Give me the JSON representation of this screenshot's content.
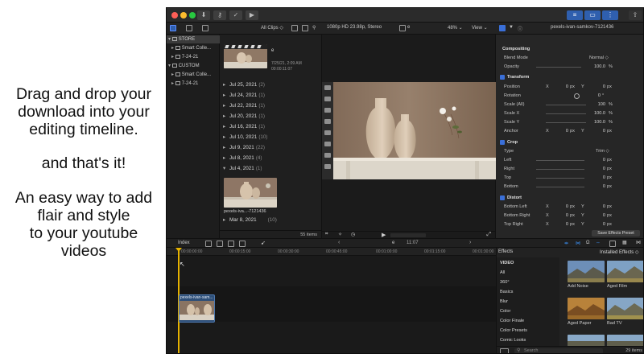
{
  "promo": {
    "line1": "Drag and drop your",
    "line2": "download into your",
    "line3": "editing timeline.",
    "line4": "and that's it!",
    "line5": "An easy way to add",
    "line6": "flair and style",
    "line7": "to your youtube",
    "line8": "videos"
  },
  "titlebar": {
    "right_buttons": [
      "≡",
      "▭",
      "⋮"
    ]
  },
  "toolbar": {
    "all_clips": "All Clips ◇",
    "format": "1080p HD 23.98p, Stereo",
    "clip_name": "e",
    "zoom": "48% ⌄",
    "view": "View ⌄",
    "inspector_title": "pexels-ivan-samkov-7121436"
  },
  "library": {
    "items": [
      {
        "label": "STORE",
        "selected": true
      },
      {
        "label": "Smart Colle...",
        "selected": false
      },
      {
        "label": "7-24-21",
        "selected": false
      },
      {
        "label": "CUSTOM",
        "selected": false
      },
      {
        "label": "Smart Colle...",
        "selected": false
      },
      {
        "label": "7-24-21",
        "selected": false
      }
    ]
  },
  "browser": {
    "top_clip": {
      "name": "e",
      "date": "7/25/21, 2:09 AM",
      "duration": "00:00:11:07"
    },
    "dates": [
      {
        "label": "Jul 25, 2021",
        "count": "(2)"
      },
      {
        "label": "Jul 24, 2021",
        "count": "(1)"
      },
      {
        "label": "Jul 22, 2021",
        "count": "(1)"
      },
      {
        "label": "Jul 20, 2021",
        "count": "(1)"
      },
      {
        "label": "Jul 16, 2021",
        "count": "(1)"
      },
      {
        "label": "Jul 10, 2021",
        "count": "(10)"
      },
      {
        "label": "Jul 9, 2021",
        "count": "(22)"
      },
      {
        "label": "Jul 8, 2021",
        "count": "(4)"
      },
      {
        "label": "Jul 4, 2021",
        "count": "(1)"
      }
    ],
    "expanded_clip_name": "pexels-iva...-7121436",
    "mar_label": "Mar 8, 2021",
    "mar_count": "(10)",
    "items_count": "55 items"
  },
  "inspector": {
    "compositing": "Compositing",
    "blend_mode_label": "Blend Mode",
    "blend_mode_value": "Normal ◇",
    "opacity_label": "Opacity",
    "opacity_value": "100.0",
    "transform": "Transform",
    "position_label": "Position",
    "rotation_label": "Rotation",
    "scale_all_label": "Scale (All)",
    "scale_x_label": "Scale X",
    "scale_y_label": "Scale Y",
    "anchor_label": "Anchor",
    "crop": "Crop",
    "type_label": "Type",
    "type_value": "Trim ◇",
    "left_label": "Left",
    "right_label": "Right",
    "top_label": "Top",
    "bottom_label": "Bottom",
    "distort": "Distort",
    "bottom_left_label": "Bottom Left",
    "bottom_right_label": "Bottom Right",
    "top_right_label": "Top Right",
    "save_preset": "Save Effects Preset",
    "x_label": "X",
    "y_label": "Y",
    "zero": "0",
    "px": "px",
    "pct": "%",
    "deg": "°",
    "scale_value": "100",
    "scale_xy_value": "100.0"
  },
  "midbar": {
    "index": "Index",
    "clip_name": "e",
    "timecode": "11:07"
  },
  "timeline": {
    "ruler": [
      "00:00:00:00",
      "00:00:15:00",
      "00:00:30:00",
      "00:00:45:00",
      "00:01:00:00",
      "00:01:15:00",
      "00:01:30:00"
    ],
    "clip_label": "pexels-ivan-sam..."
  },
  "effects": {
    "title": "Effects",
    "installed": "Installed Effects ◇",
    "categories": [
      "VIDEO",
      "All",
      "360°",
      "Basics",
      "Blur",
      "Color",
      "Color Finale",
      "Color Presets",
      "Comic Looks"
    ],
    "thumbs": [
      {
        "label": "Add Noise"
      },
      {
        "label": "Aged Film"
      },
      {
        "label": "Aged Paper"
      },
      {
        "label": "Bad TV"
      }
    ],
    "search_placeholder": "Search",
    "items_count": "29 items"
  },
  "colors": {
    "accent": "#3a6fd8",
    "playhead": "#e6b300",
    "selected_blue": "#2f5fae"
  }
}
